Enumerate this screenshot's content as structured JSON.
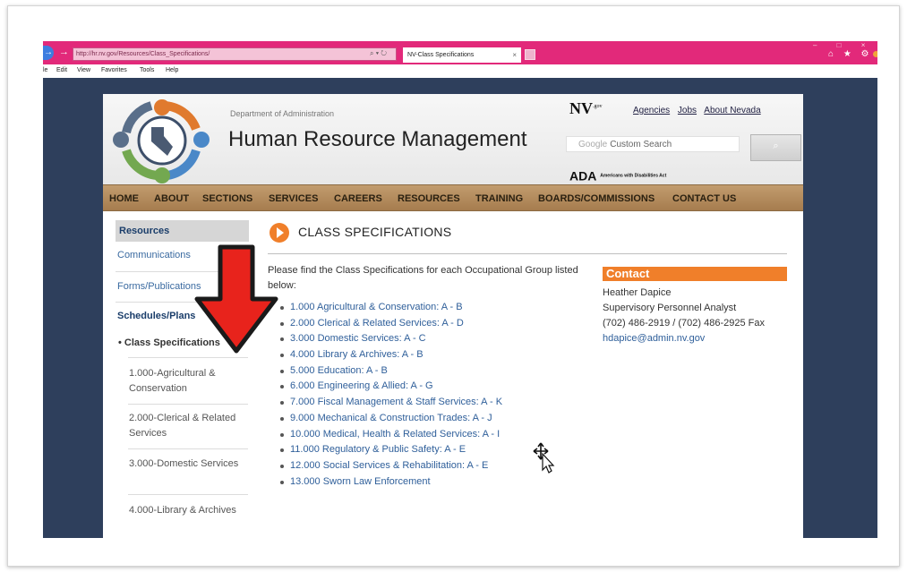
{
  "browser": {
    "url": "http://hr.nv.gov/Resources/Class_Specifications/",
    "url_tools": "⌕ ▾ ↻",
    "tab_title": "NV-Class Specifications",
    "tab_close": "×",
    "nav_back": "→",
    "nav_forward": "→",
    "window_controls": "– □ ×",
    "right_icons": "⌂ ★ ⚙",
    "menu": [
      "le",
      "Edit",
      "View",
      "Favorites",
      "Tools",
      "Help"
    ]
  },
  "header": {
    "department": "Department of Administration",
    "title": "Human Resource Management",
    "nv_logo": "NV",
    "nv_sup": ".gov",
    "links": [
      "Agencies",
      "Jobs",
      "About Nevada"
    ],
    "search_brand": "Google",
    "search_placeholder": "Custom Search",
    "search_icon": "⌕",
    "ada": "ADA",
    "ada_caption": "Americans with Disabilities Act"
  },
  "nav": [
    "HOME",
    "ABOUT",
    "SECTIONS",
    "SERVICES",
    "CAREERS",
    "RESOURCES",
    "TRAINING",
    "BOARDS/COMMISSIONS",
    "CONTACT US"
  ],
  "sidebar": {
    "heading": "Resources",
    "communications": "Communications",
    "forms": "Forms/Publications",
    "schedules": "Schedules/Plans",
    "class_specs": "• Class Specifications",
    "subitems": [
      "1.000-Agricultural & Conservation",
      "2.000-Clerical & Related Services",
      "3.000-Domestic Services",
      "4.000-Library & Archives"
    ]
  },
  "main": {
    "title": "CLASS SPECIFICATIONS",
    "intro": "Please find the Class Specifications for each Occupational Group listed below:",
    "items": [
      "1.000 Agricultural & Conservation: A - B",
      "2.000 Clerical & Related Services: A - D",
      "3.000 Domestic Services: A - C",
      "4.000 Library & Archives: A - B",
      "5.000 Education: A - B",
      "6.000 Engineering & Allied: A - G",
      "7.000 Fiscal Management & Staff Services: A - K",
      "9.000 Mechanical & Construction Trades: A - J",
      "10.000 Medical, Health & Related Services: A - I",
      "11.000 Regulatory & Public Safety: A - E",
      "12.000 Social Services & Rehabilitation: A - E",
      "13.000 Sworn Law Enforcement"
    ]
  },
  "contact": {
    "heading": "Contact",
    "name": "Heather Dapice",
    "role": "Supervisory Personnel Analyst",
    "phones": "(702) 486-2919 / (702) 486-2925 Fax",
    "email": "hdapice@admin.nv.gov"
  },
  "colors": {
    "browser_chrome": "#e2297a",
    "nav_bar": "#b08858",
    "accent_orange": "#f07f2a",
    "link_blue": "#2f5f9a",
    "arrow_red": "#e8231c"
  },
  "icons": [
    "back-icon",
    "forward-icon",
    "refresh-icon",
    "search-icon",
    "home-icon",
    "star-icon",
    "gear-icon",
    "play-circle-icon",
    "arrow-down-icon",
    "move-cursor-icon"
  ]
}
